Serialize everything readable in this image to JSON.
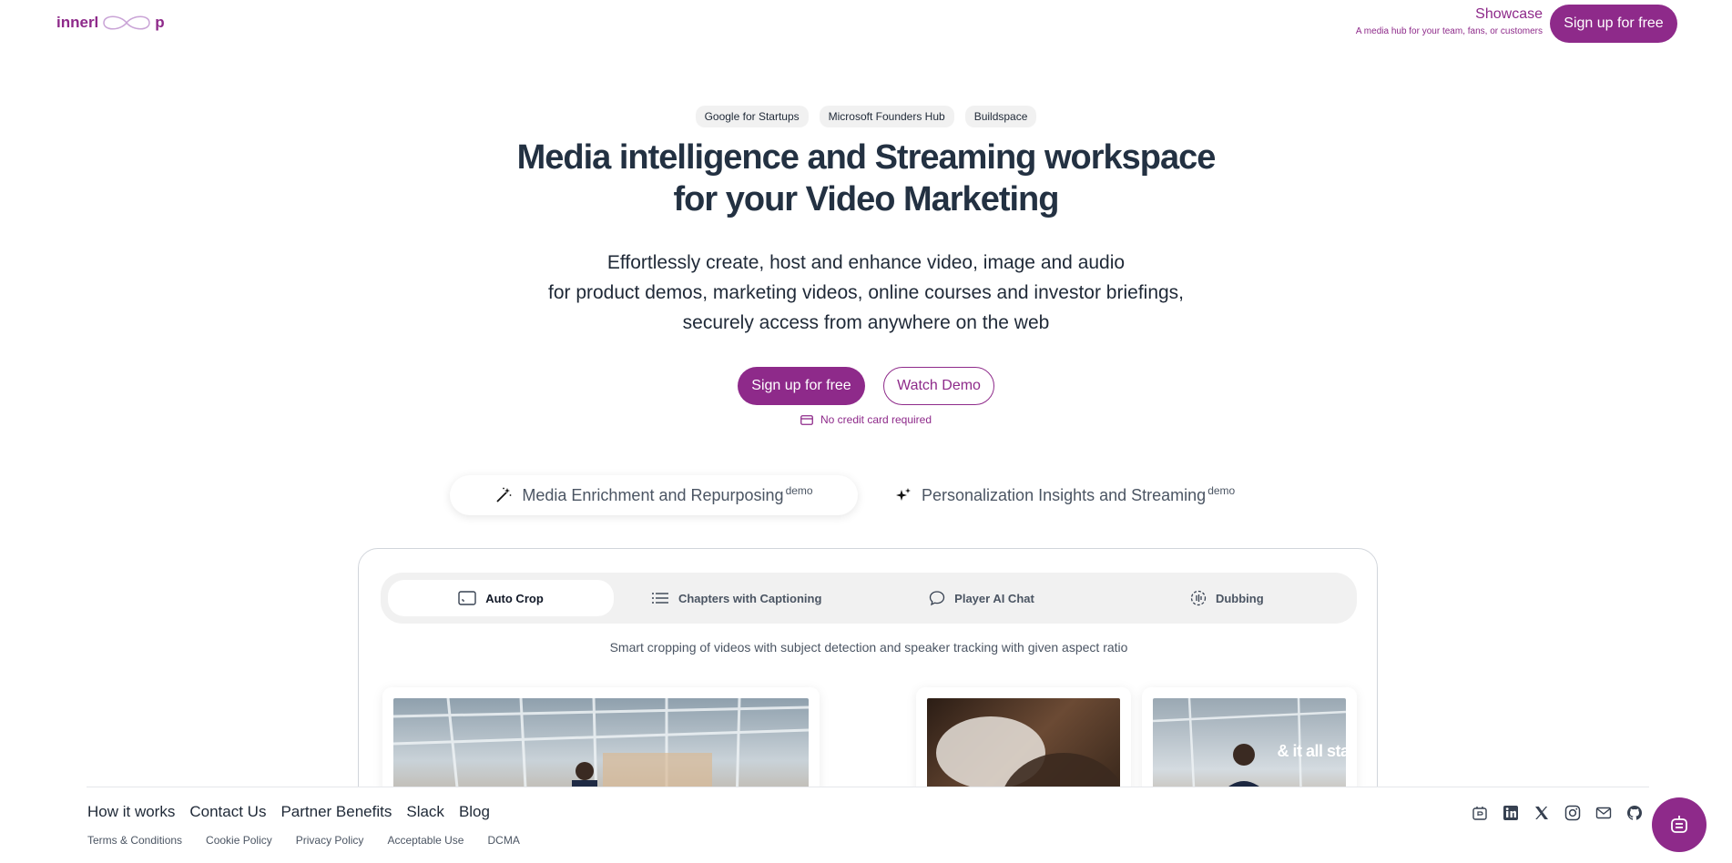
{
  "header": {
    "logo_left": "innerl",
    "logo_right": "p",
    "showcase_title": "Showcase",
    "showcase_subtitle": "A media hub for your team, fans, or customers",
    "signup_label": "Sign up for free"
  },
  "hero": {
    "badges": [
      "Google for Startups",
      "Microsoft Founders Hub",
      "Buildspace"
    ],
    "title_line1": "Media intelligence and Streaming workspace",
    "title_line2": "for your Video Marketing",
    "subtitle_line1": "Effortlessly create, host and enhance video, image and audio",
    "subtitle_line2": "for product demos, marketing videos, online courses and investor briefings,",
    "subtitle_line3": "securely access from anywhere on the web",
    "signup_label": "Sign up for free",
    "demo_label": "Watch Demo",
    "no_cc": "No credit card required"
  },
  "main_tabs": [
    {
      "label": "Media Enrichment and Repurposing",
      "sup": "demo",
      "icon": "magic-wand-icon"
    },
    {
      "label": "Personalization Insights and Streaming",
      "sup": "demo",
      "icon": "sparkles-icon"
    }
  ],
  "sub_tabs": [
    {
      "label": "Auto Crop",
      "icon": "crop-frame-icon"
    },
    {
      "label": "Chapters with Captioning",
      "icon": "list-icon"
    },
    {
      "label": "Player AI Chat",
      "icon": "chat-icon"
    },
    {
      "label": "Dubbing",
      "icon": "audio-icon"
    }
  ],
  "card": {
    "description": "Smart cropping of videos with subject detection and speaker tracking with given aspect ratio",
    "overlay_text": "& it all star"
  },
  "footer": {
    "links": [
      "How it works",
      "Contact Us",
      "Partner Benefits",
      "Slack",
      "Blog"
    ],
    "legal": [
      "Terms & Conditions",
      "Cookie Policy",
      "Privacy Policy",
      "Acceptable Use",
      "DCMA"
    ],
    "social_icons": [
      "producthunt-icon",
      "linkedin-icon",
      "x-icon",
      "instagram-icon",
      "mail-icon",
      "github-icon"
    ]
  },
  "colors": {
    "brand": "#8e2a8a",
    "heading": "#233142"
  }
}
